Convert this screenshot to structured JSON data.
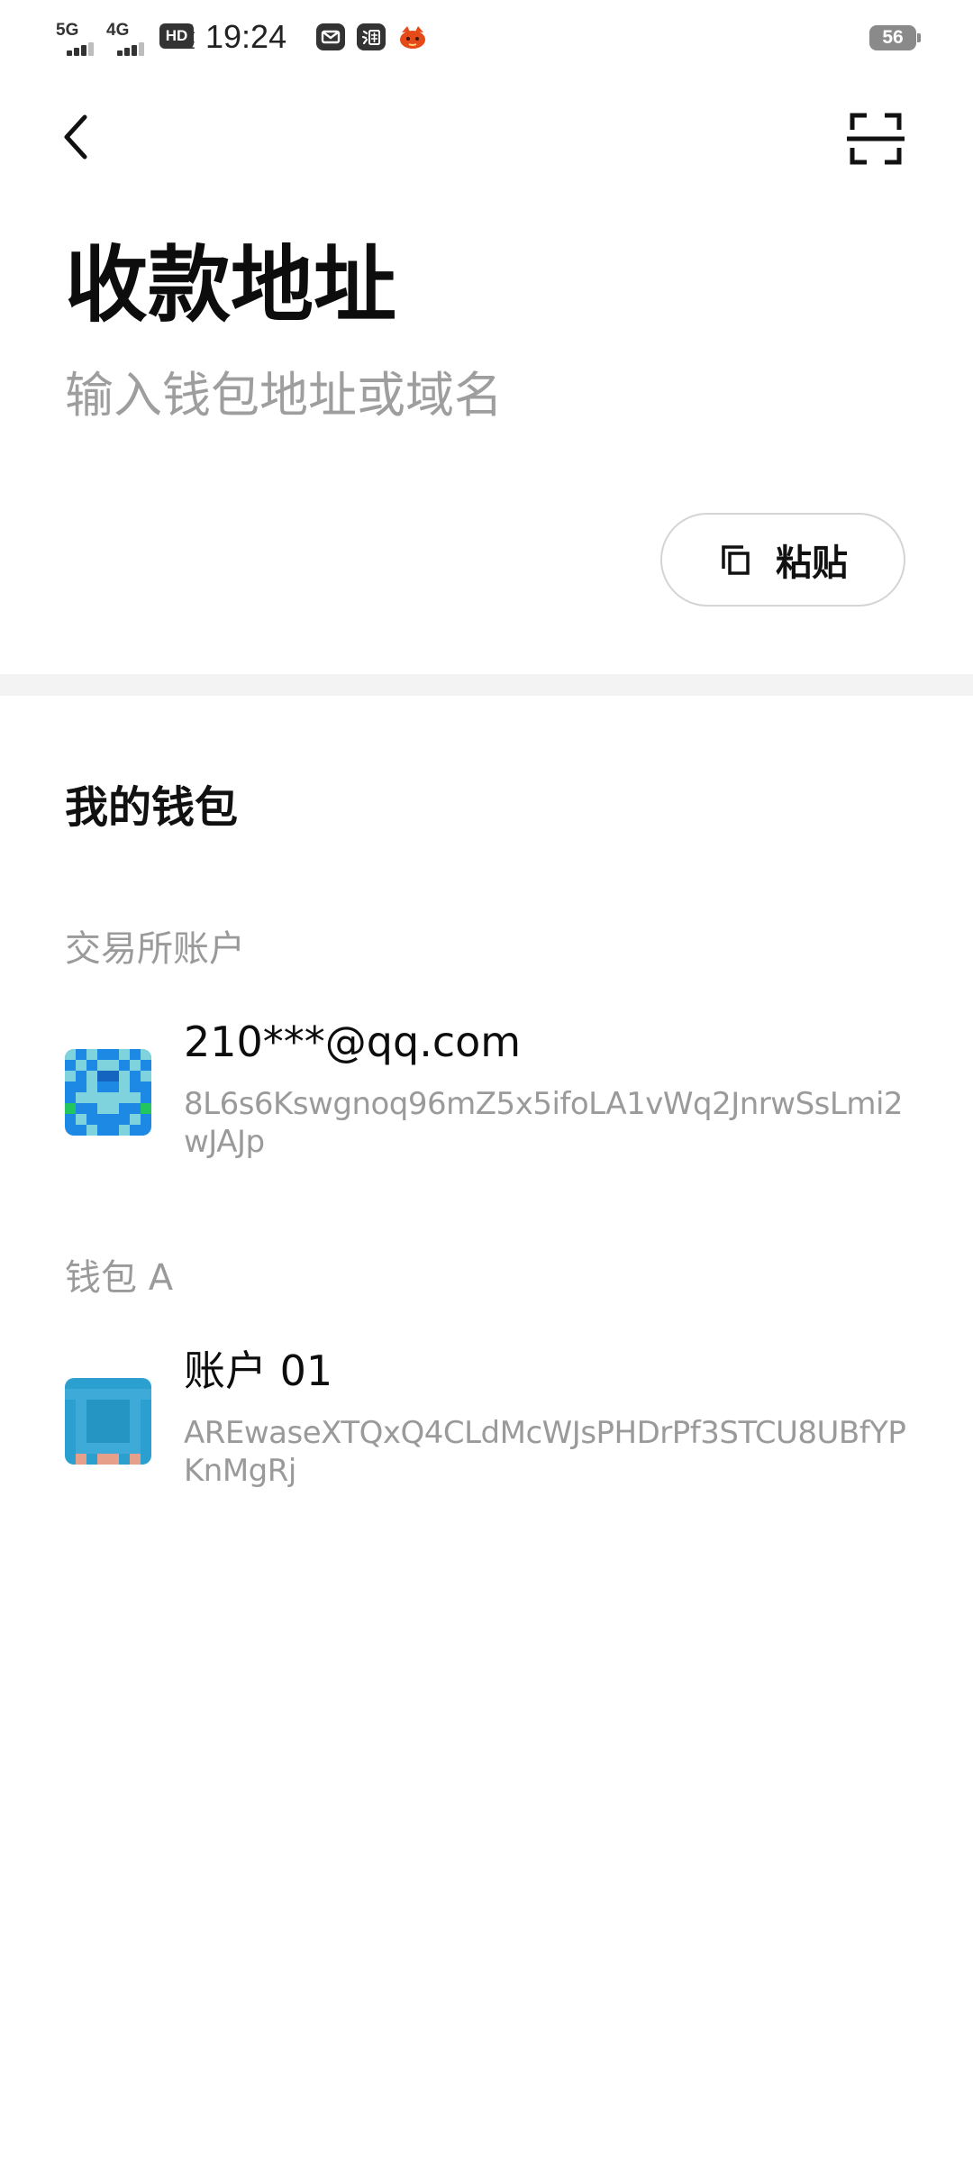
{
  "status_bar": {
    "network_1": "5G",
    "network_2": "4G",
    "hd_label": "HD",
    "hd_sub": "1 2",
    "time": "19:24",
    "notification_icons": [
      "mail-icon",
      "taobao-icon",
      "fox-app-icon"
    ],
    "battery": "56"
  },
  "header": {
    "title": "收款地址",
    "input_placeholder": "输入钱包地址或域名",
    "input_value": "",
    "paste_label": "粘贴"
  },
  "wallets": {
    "section_title": "我的钱包",
    "groups": [
      {
        "label": "交易所账户",
        "accounts": [
          {
            "name": "210***@qq.com",
            "address": "8L6s6Kswgnoq96mZ5x5ifoLA1vWq2JnrwSsLmi2wJAJp"
          }
        ]
      },
      {
        "label": "钱包 A",
        "accounts": [
          {
            "name": "账户 01",
            "address": "AREwaseXTQxQ4CLdMcWJsPHDrPf3STCU8UBfYPKnMgRj"
          }
        ]
      }
    ]
  },
  "colors": {
    "background": "#ffffff",
    "primary_text": "#111111",
    "secondary_text": "#9a9a9a",
    "divider": "#f3f3f3",
    "button_border": "#d4d4d4"
  }
}
